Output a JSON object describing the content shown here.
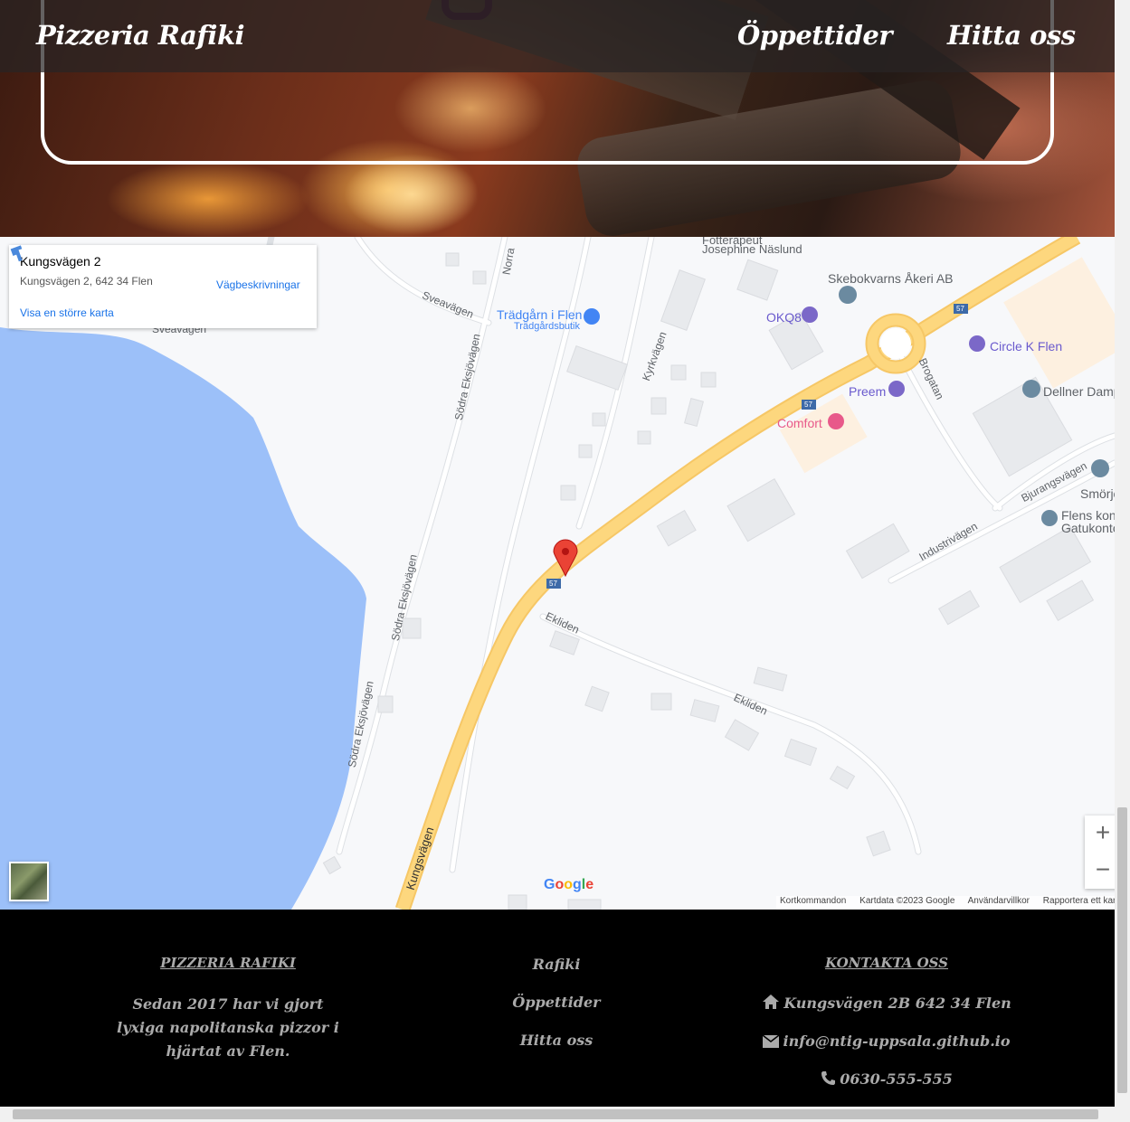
{
  "nav": {
    "brand": "Pizzeria Rafiki",
    "links": [
      "Öppettider",
      "Hitta oss"
    ]
  },
  "map": {
    "info": {
      "title": "Kungsvägen 2",
      "address": "Kungsvägen 2, 642 34 Flen",
      "directions": "Vägbeskrivningar",
      "larger_map": "Visa en större karta"
    },
    "labels": {
      "sveavagen": "Sveavägen",
      "sveavagen2": "Sveavägen",
      "norra": "Norra",
      "sodra1": "Södra Eksjövägen",
      "sodra2": "Södra Eksjövägen",
      "sodra3": "Södra Eksjövägen",
      "kyrkvagen": "Kyrkvägen",
      "kungsvagen": "Kungsvägen",
      "ekliden1": "Ekliden",
      "ekliden2": "Ekliden",
      "brogatan": "Brogatan",
      "industrivagen": "Industrivägen",
      "bjurangsvagen": "Bjurangsvägen",
      "fotterapeut1": "Fotterapeut",
      "fotterapeut2": "Josephine Näslund",
      "route57": "57"
    },
    "pois": {
      "tradgard": "Trädgårn i Flen",
      "tradgard_sub": "Trädgårdsbutik",
      "skebokvarns": "Skebokvarns Åkeri AB",
      "okq8": "OKQ8",
      "circlek": "Circle K Flen",
      "preem": "Preem",
      "comfort": "Comfort",
      "dellner": "Dellner Damp",
      "smorj": "Smörjo",
      "flens1": "Flens kon",
      "flens2": "Gatukonto"
    },
    "zoom_in": "+",
    "zoom_out": "−",
    "google": "Google",
    "attribution": [
      "Kortkommandon",
      "Kartdata ©2023 Google",
      "Användarvillkor",
      "Rapportera ett kartfel"
    ]
  },
  "footer": {
    "col1": {
      "title": "PIZZERIA RAFIKI",
      "text": "Sedan 2017 har vi gjort lyxiga napolitanska pizzor i hjärtat av Flen."
    },
    "col2": {
      "links": [
        "Rafiki",
        "Öppettider",
        "Hitta oss"
      ]
    },
    "col3": {
      "title": "KONTAKTA OSS",
      "address": "Kungsvägen 2B 642 34 Flen",
      "email": "info@ntig-uppsala.github.io",
      "phone": "0630-555-555"
    }
  },
  "icons": {
    "home": "home-icon",
    "mail": "envelope-icon",
    "phone": "phone-icon",
    "instagram": "instagram-icon"
  },
  "colors": {
    "water": "#9cc0f9",
    "road_major": "#fdd77e",
    "road_minor": "#ffffff",
    "pin": "#ea4335",
    "link": "#1a73e8"
  }
}
